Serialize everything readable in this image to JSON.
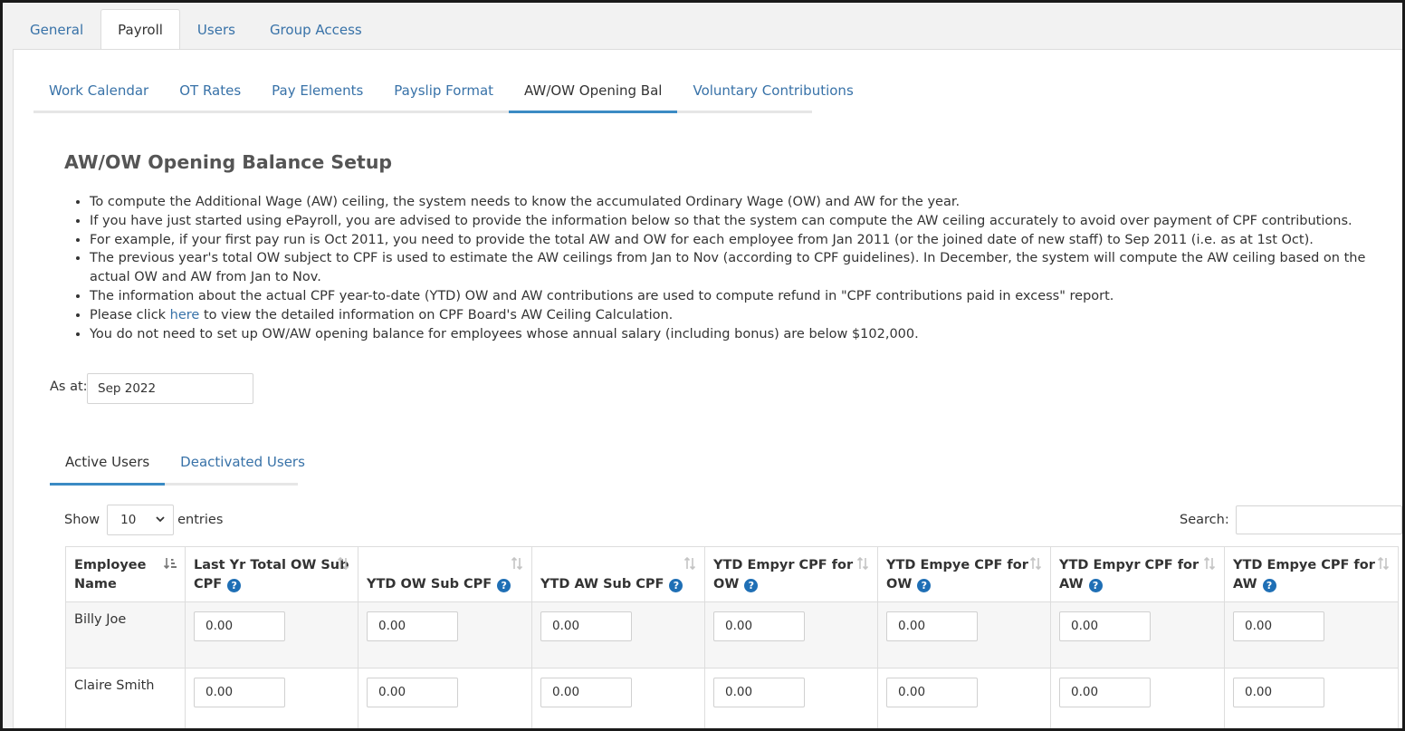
{
  "top_tabs": [
    {
      "label": "General",
      "active": false
    },
    {
      "label": "Payroll",
      "active": true
    },
    {
      "label": "Users",
      "active": false
    },
    {
      "label": "Group Access",
      "active": false
    }
  ],
  "sub_tabs": [
    {
      "label": "Work Calendar",
      "active": false
    },
    {
      "label": "OT Rates",
      "active": false
    },
    {
      "label": "Pay Elements",
      "active": false
    },
    {
      "label": "Payslip Format",
      "active": false
    },
    {
      "label": "AW/OW Opening Bal",
      "active": true
    },
    {
      "label": "Voluntary Contributions",
      "active": false
    }
  ],
  "page_title": "AW/OW Opening Balance Setup",
  "info": {
    "b1": "To compute the Additional Wage (AW) ceiling, the system needs to know the accumulated Ordinary Wage (OW) and AW for the year.",
    "b2": "If you have just started using ePayroll, you are advised to provide the information below so that the system can compute the AW ceiling accurately to avoid over payment of CPF contributions.",
    "b3": "For example, if your first pay run is Oct 2011, you need to provide the total AW and OW for each employee from Jan 2011 (or the joined date of new staff) to Sep 2011 (i.e. as at 1st Oct).",
    "b4": "The previous year's total OW subject to CPF is used to estimate the AW ceilings from Jan to Nov (according to CPF guidelines). In December, the system will compute the AW ceiling based on the actual OW and AW from Jan to Nov.",
    "b5": "The information about the actual CPF year-to-date (YTD) OW and AW contributions are used to compute refund in \"CPF contributions paid in excess\" report.",
    "b6_pre": "Please click ",
    "b6_link": "here",
    "b6_post": " to view the detailed information on CPF Board's AW Ceiling Calculation.",
    "b7": "You do not need to set up OW/AW opening balance for employees whose annual salary (including bonus) are below $102,000."
  },
  "as_at": {
    "label": "As at:",
    "value": "Sep 2022"
  },
  "user_tabs": [
    {
      "label": "Active Users",
      "active": true
    },
    {
      "label": "Deactivated Users",
      "active": false
    }
  ],
  "table_controls": {
    "show_label": "Show",
    "entries_value": "10",
    "entries_label": "entries",
    "search_label": "Search:"
  },
  "table": {
    "help_glyph": "?",
    "columns": [
      "Employee Name",
      "Last Yr Total OW Sub CPF",
      "YTD OW Sub CPF",
      "YTD AW Sub CPF",
      "YTD Empyr CPF for OW",
      "YTD Empye CPF for OW",
      "YTD Empyr CPF for AW",
      "YTD Empye CPF for AW"
    ],
    "rows": [
      {
        "name": "Billy Joe",
        "values": [
          "0.00",
          "0.00",
          "0.00",
          "0.00",
          "0.00",
          "0.00",
          "0.00"
        ]
      },
      {
        "name": "Claire Smith",
        "values": [
          "0.00",
          "0.00",
          "0.00",
          "0.00",
          "0.00",
          "0.00",
          "0.00"
        ]
      }
    ]
  },
  "colors": {
    "link": "#3872a8",
    "active_underline": "#3b8bc4",
    "help_icon": "#1f6fb5"
  }
}
